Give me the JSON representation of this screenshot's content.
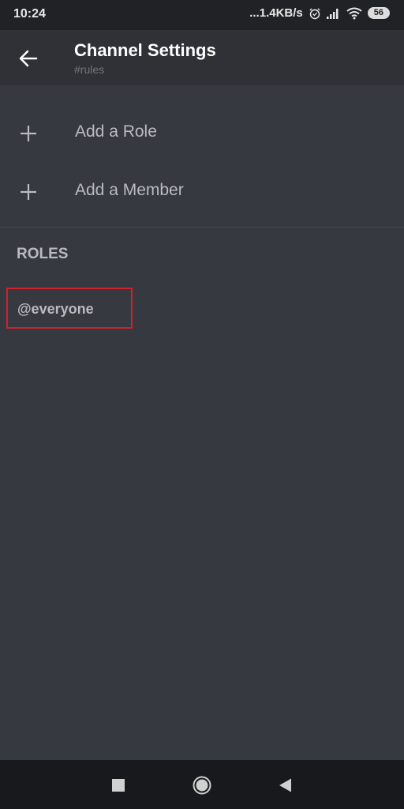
{
  "status_bar": {
    "time": "10:24",
    "network_speed": "...1.4KB/s",
    "battery": "56",
    "icons": [
      "alarm-icon",
      "signal-icon",
      "wifi-icon",
      "battery-icon"
    ]
  },
  "header": {
    "title": "Channel Settings",
    "subtitle": "#rules",
    "back_icon": "arrow-left-icon"
  },
  "actions": [
    {
      "label": "Add a Role",
      "icon": "plus-icon"
    },
    {
      "label": "Add a Member",
      "icon": "plus-icon"
    }
  ],
  "roles": {
    "header": "ROLES",
    "items": [
      {
        "label": "@everyone",
        "highlighted": true
      }
    ]
  },
  "colors": {
    "background": "#36393f",
    "app_bar": "#2f3136",
    "highlight": "#d3202b"
  },
  "nav_bar": {
    "buttons": [
      "recents-icon",
      "home-icon",
      "back-icon"
    ]
  }
}
